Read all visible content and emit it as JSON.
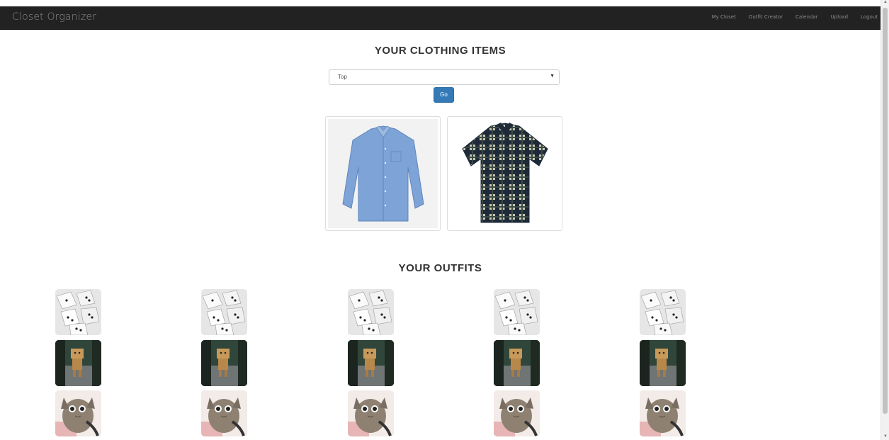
{
  "navbar": {
    "brand": "Closet Organizer",
    "links": [
      "My Closet",
      "Outfit Creator",
      "Calendar",
      "Upload",
      "Logout"
    ]
  },
  "clothing": {
    "heading": "YOUR CLOTHING ITEMS",
    "select_value": "Top",
    "go_label": "Go",
    "items": [
      "blue-shirt",
      "plaid-shirt"
    ]
  },
  "outfits": {
    "heading": "YOUR OUTFITS",
    "columns": 5,
    "rows": [
      "dice-image",
      "robot-image",
      "kitten-image"
    ]
  },
  "colors": {
    "navbar_bg": "#222222",
    "nav_text": "#8c8c8c",
    "primary_button": "#337ab7"
  }
}
